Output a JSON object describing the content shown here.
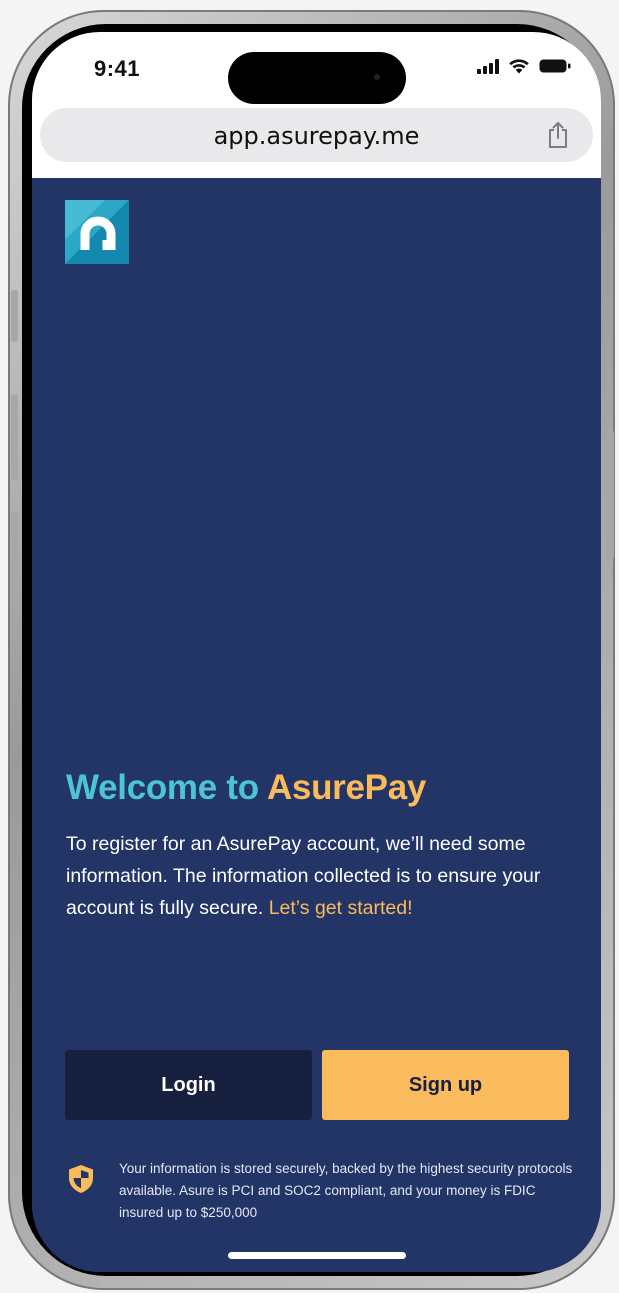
{
  "status_bar": {
    "time": "9:41"
  },
  "browser": {
    "url": "app.asurepay.me",
    "share_icon": "share-icon"
  },
  "brand": {
    "logo_icon": "asurepay-logo",
    "teal": "#4cc4d5",
    "orange": "#f9bb5b",
    "navy": "#233467"
  },
  "welcome": {
    "title_prefix": "Welcome to",
    "title_brand": "AsurePay",
    "body": "To register for an AsurePay account, we’ll need some information. The information collected is to ensure your account is fully secure.",
    "cta": "Let’s get started!"
  },
  "actions": {
    "login_label": "Login",
    "signup_label": "Sign up"
  },
  "security": {
    "icon": "shield-icon",
    "text": "Your information is stored securely, backed by the highest security protocols available.  Asure is PCI and SOC2 compliant, and your money is FDIC insured up to $250,000"
  }
}
